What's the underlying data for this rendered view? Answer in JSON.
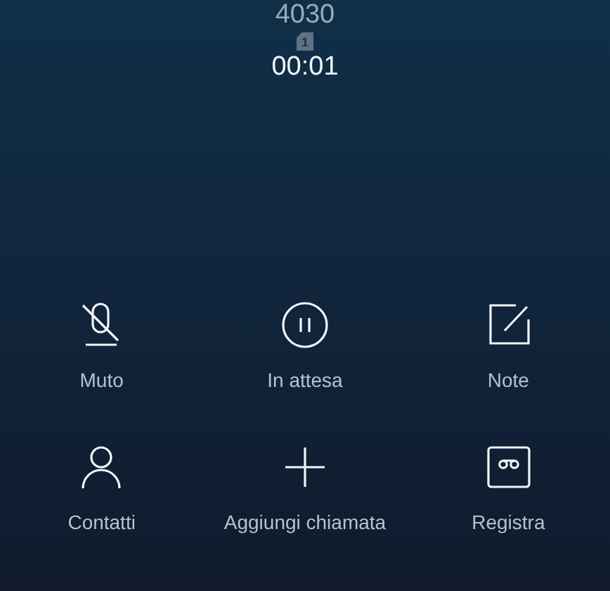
{
  "call": {
    "number": "4030",
    "sim_slot": "1",
    "duration": "00:01"
  },
  "actions": [
    {
      "kind": "mute",
      "label": "Muto"
    },
    {
      "kind": "hold",
      "label": "In attesa"
    },
    {
      "kind": "notes",
      "label": "Note"
    },
    {
      "kind": "contacts",
      "label": "Contatti"
    },
    {
      "kind": "add",
      "label": "Aggiungi chiamata"
    },
    {
      "kind": "record",
      "label": "Registra"
    }
  ]
}
